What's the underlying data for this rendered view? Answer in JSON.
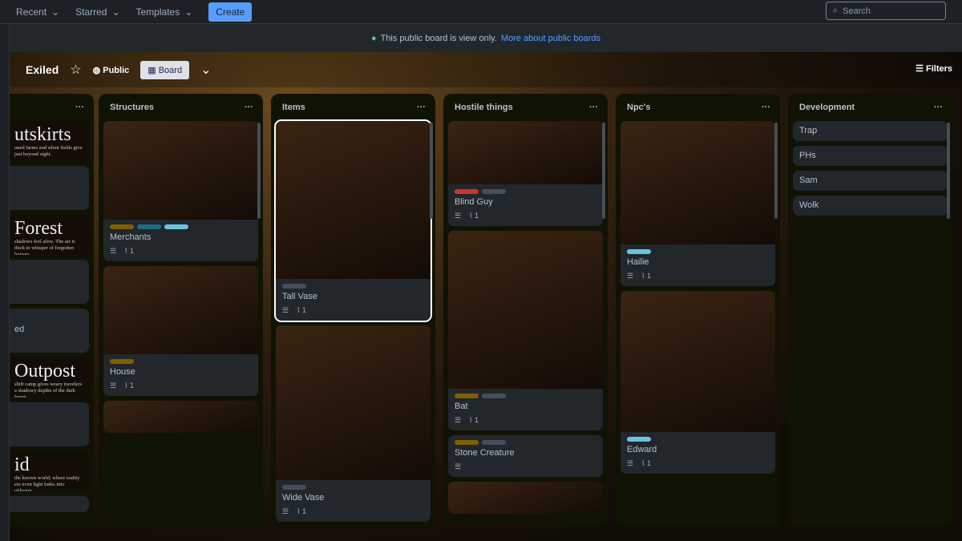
{
  "topbar": {
    "nav": [
      "Recent",
      "Starred",
      "Templates"
    ],
    "create": "Create",
    "search_placeholder": "Search"
  },
  "notice": {
    "text": "This public board is view only.",
    "link": "More about public boards"
  },
  "board": {
    "title": "Exiled",
    "visibility": "Public",
    "view": "Board",
    "filters": "Filters"
  },
  "partial_list": {
    "covers": [
      {
        "title": "utskirts",
        "sub": "oned farms and silent fields give just beyond sight."
      },
      {
        "title": "Forest",
        "sub": "shadows feel alive. The air is thick to whisper of forgotten horrors."
      },
      {
        "title": "Outpost",
        "sub": "shift camp gives weary travelers a shadowy depths of the dark forest."
      },
      {
        "title": "id",
        "sub": "the known world, where reality ere even light fades into oblivion."
      }
    ],
    "card_text": "ed"
  },
  "lists": [
    {
      "title": "Structures",
      "cards": [
        {
          "title": "Merchants",
          "labels": [
            "#7f5f01",
            "#206a83",
            "#6cc3e0"
          ],
          "desc": true,
          "attachments": "1",
          "img": 123
        },
        {
          "title": "House",
          "labels": [
            "#7f5f01"
          ],
          "desc": true,
          "attachments": "1",
          "img": 110
        },
        {
          "title": "",
          "labels": [],
          "img": 140
        }
      ]
    },
    {
      "title": "Items",
      "cards": [
        {
          "title": "Tall Vase",
          "labels": [
            "#454f59"
          ],
          "desc": true,
          "attachments": "1",
          "img": 197,
          "selected": true
        },
        {
          "title": "Wide Vase",
          "labels": [
            "#454f59"
          ],
          "desc": true,
          "attachments": "1",
          "img": 193
        }
      ]
    },
    {
      "title": "Hostile things",
      "cards": [
        {
          "title": "Blind Guy",
          "labels": [
            "#c9372c",
            "#454f59"
          ],
          "desc": true,
          "attachments": "1",
          "img": 79
        },
        {
          "title": "Bat",
          "labels": [
            "#7f5f01",
            "#454f59"
          ],
          "desc": true,
          "attachments": "1",
          "img": 197
        },
        {
          "title": "Stone Creature",
          "labels": [
            "#7f5f01",
            "#454f59"
          ],
          "desc": true
        },
        {
          "title": "",
          "labels": [],
          "img": 60
        }
      ]
    },
    {
      "title": "Npc's",
      "cards": [
        {
          "title": "Hailie",
          "labels": [
            "#6cc3e0"
          ],
          "desc": true,
          "attachments": "1",
          "img": 154
        },
        {
          "title": "Edward",
          "labels": [
            "#6cc3e0"
          ],
          "desc": true,
          "attachments": "1",
          "img": 176
        }
      ]
    },
    {
      "title": "Development",
      "cards": [
        {
          "title": "Trap"
        },
        {
          "title": "PHs"
        },
        {
          "title": "Sam"
        },
        {
          "title": "Wolk"
        }
      ]
    }
  ]
}
